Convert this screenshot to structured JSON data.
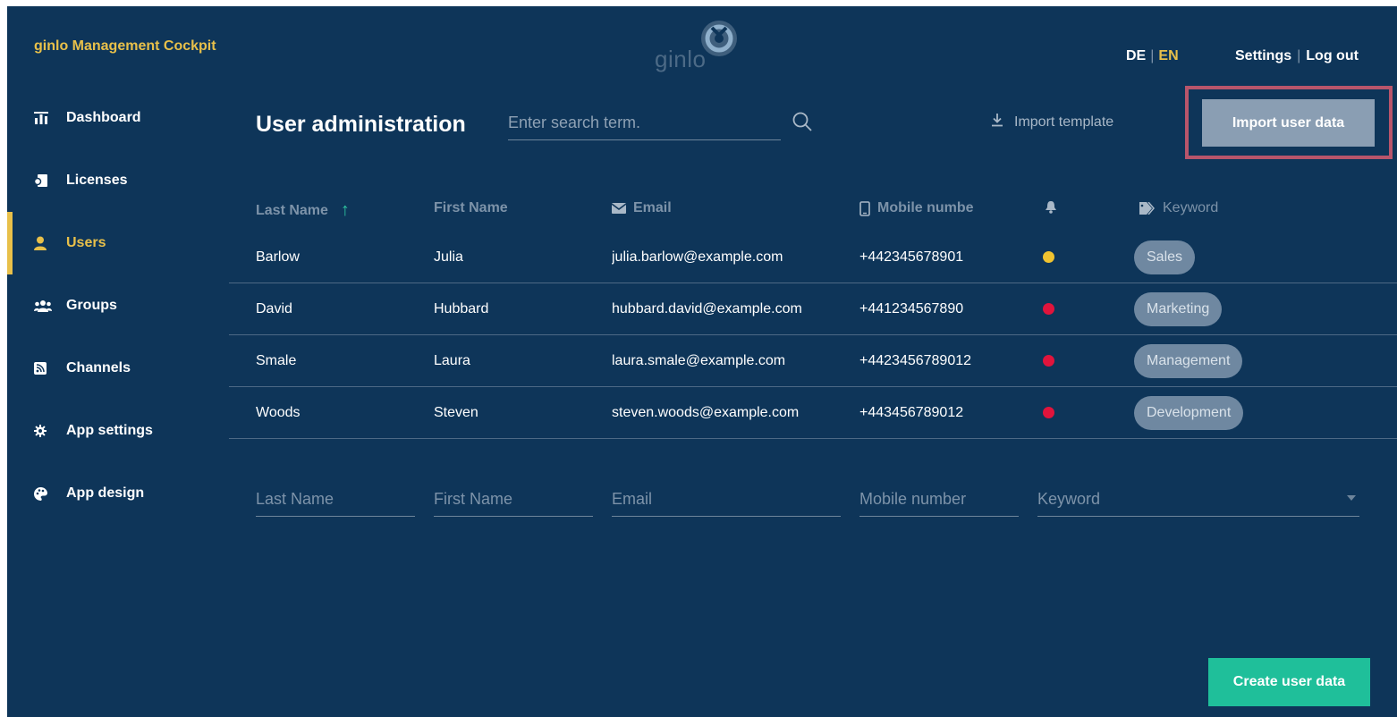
{
  "header": {
    "brand": "ginlo Management Cockpit",
    "logo_text": "ginlo",
    "lang_de": "DE",
    "lang_en": "EN",
    "settings": "Settings",
    "logout": "Log out"
  },
  "sidebar": {
    "items": [
      {
        "label": "Dashboard",
        "icon": "dashboard-icon"
      },
      {
        "label": "Licenses",
        "icon": "licenses-icon"
      },
      {
        "label": "Users",
        "icon": "user-icon",
        "active": true
      },
      {
        "label": "Groups",
        "icon": "groups-icon"
      },
      {
        "label": "Channels",
        "icon": "channels-icon"
      },
      {
        "label": "App settings",
        "icon": "gear-icon"
      },
      {
        "label": "App design",
        "icon": "palette-icon"
      }
    ]
  },
  "main": {
    "title": "User administration",
    "search_placeholder": "Enter search term.",
    "import_template": "Import template",
    "import_user_data": "Import user data",
    "create_user_data": "Create user data"
  },
  "table": {
    "columns": {
      "last_name": "Last Name",
      "first_name": "First Name",
      "email": "Email",
      "mobile": "Mobile numbe",
      "keyword": "Keyword"
    },
    "rows": [
      {
        "last": "Barlow",
        "first": "Julia",
        "email": "julia.barlow@example.com",
        "mobile": "+442345678901",
        "status": "#f0c330",
        "keyword": "Sales"
      },
      {
        "last": "David",
        "first": "Hubbard",
        "email": "hubbard.david@example.com",
        "mobile": "+441234567890",
        "status": "#e0143c",
        "keyword": "Marketing"
      },
      {
        "last": "Smale",
        "first": "Laura",
        "email": "laura.smale@example.com",
        "mobile": "+4423456789012",
        "status": "#e0143c",
        "keyword": "Management"
      },
      {
        "last": "Woods",
        "first": "Steven",
        "email": "steven.woods@example.com",
        "mobile": "+443456789012",
        "status": "#e0143c",
        "keyword": "Development"
      }
    ]
  },
  "new_row": {
    "last_placeholder": "Last Name",
    "first_placeholder": "First Name",
    "email_placeholder": "Email",
    "mobile_placeholder": "Mobile number",
    "keyword_placeholder": "Keyword"
  },
  "colors": {
    "background": "#0e3559",
    "accent_yellow": "#e8c04a",
    "accent_green": "#1fbf9a",
    "highlight": "#b8556b"
  }
}
